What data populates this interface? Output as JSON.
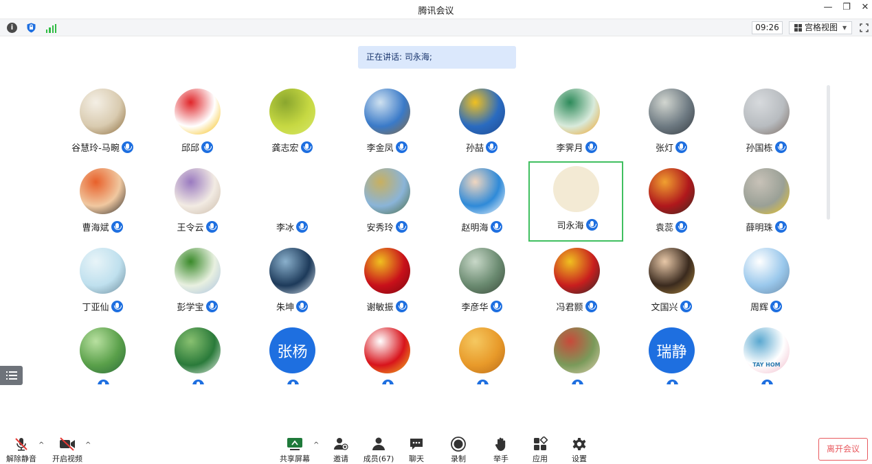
{
  "window": {
    "title": "腾讯会议",
    "minimize_glyph": "—",
    "restore_glyph": "❐",
    "close_glyph": "✕"
  },
  "status": {
    "info_icon": "i",
    "time": "09:26",
    "view_label": "宫格视图",
    "view_caret": "▼"
  },
  "speaking": {
    "text": "正在讲话: 司永海;"
  },
  "participants": [
    {
      "name": "谷慧玲-马畹",
      "avatar": "teacup",
      "colors": [
        "#d9cbb0",
        "#f4efe5",
        "#8a6a3a"
      ]
    },
    {
      "name": "邱邱",
      "avatar": "logo-red",
      "colors": [
        "#ffffff",
        "#e0262a",
        "#f5b800"
      ]
    },
    {
      "name": "龚志宏",
      "avatar": "tree",
      "colors": [
        "#c6d842",
        "#8aa62e",
        "#d8e86a"
      ]
    },
    {
      "name": "李金凤",
      "avatar": "person-field",
      "colors": [
        "#3a7ac8",
        "#cfe1f0",
        "#8a6a3c"
      ]
    },
    {
      "name": "孙喆",
      "avatar": "yellow-leaves",
      "colors": [
        "#2a6bc0",
        "#f0c020",
        "#1f4a90"
      ]
    },
    {
      "name": "李霁月",
      "avatar": "umbrella",
      "colors": [
        "#d8eadb",
        "#2d8a5a",
        "#f0a020"
      ]
    },
    {
      "name": "张灯",
      "avatar": "child-window",
      "colors": [
        "#6e7a82",
        "#d2d6d0",
        "#343a40"
      ]
    },
    {
      "name": "孙国栋",
      "avatar": "building",
      "colors": [
        "#b8bcc0",
        "#d7dadd",
        "#7a6a60"
      ]
    },
    {
      "name": "曹海斌",
      "avatar": "boy-glasses",
      "colors": [
        "#f0c8a0",
        "#e8602a",
        "#2a2a2a"
      ]
    },
    {
      "name": "王令云",
      "avatar": "lavender",
      "colors": [
        "#f2ebe3",
        "#9a7ac0",
        "#c9b8a6"
      ]
    },
    {
      "name": "李冰",
      "avatar": "calligraphy",
      "colors": [
        "#ffffff",
        "#111111",
        "#9e9e9e"
      ]
    },
    {
      "name": "安秀玲",
      "avatar": "lake-trees",
      "colors": [
        "#8ab4d8",
        "#c8b060",
        "#4a6a40"
      ]
    },
    {
      "name": "赵明海",
      "avatar": "man-portrait",
      "colors": [
        "#2f8ad8",
        "#f0d6c0",
        "#ffffff"
      ]
    },
    {
      "name": "司永海",
      "avatar": "si-calligraphy",
      "colors": [
        "#f3ead4",
        "#222222",
        "#e07a9a"
      ]
    },
    {
      "name": "袁蕊",
      "avatar": "tiger",
      "colors": [
        "#b0181c",
        "#f0a030",
        "#3a2a20"
      ]
    },
    {
      "name": "薛明珠",
      "avatar": "blossom",
      "colors": [
        "#9aa096",
        "#c8c2b8",
        "#f0c820"
      ]
    },
    {
      "name": "丁亚仙",
      "avatar": "kid-sky",
      "colors": [
        "#bfe0ee",
        "#e8f4f8",
        "#6a8a9a"
      ]
    },
    {
      "name": "彭学宝",
      "avatar": "garden",
      "colors": [
        "#e8f0e0",
        "#3a8a2a",
        "#a8c0e0"
      ]
    },
    {
      "name": "朱坤",
      "avatar": "skyscraper",
      "colors": [
        "#1d3a5a",
        "#8ab0cc",
        "#dde8f0"
      ]
    },
    {
      "name": "谢敏振",
      "avatar": "star",
      "colors": [
        "#c8101a",
        "#f0c020",
        "#7a0810"
      ]
    },
    {
      "name": "李彦华",
      "avatar": "succulent",
      "colors": [
        "#6a8a70",
        "#c8d8c8",
        "#3a4a3a"
      ]
    },
    {
      "name": "冯君颢",
      "avatar": "cartoon",
      "colors": [
        "#c81e1e",
        "#f0c020",
        "#2a2a2a"
      ]
    },
    {
      "name": "文国兴",
      "avatar": "graduate",
      "colors": [
        "#3a2a1e",
        "#e8c8a8",
        "#b08a40"
      ]
    },
    {
      "name": "周辉",
      "avatar": "tower",
      "colors": [
        "#9ac8ec",
        "#ffffff",
        "#6a8aa8"
      ]
    },
    {
      "name": "",
      "avatar": "green-lake",
      "colors": [
        "#5aa04a",
        "#b8e0a0",
        "#2a6a3a"
      ]
    },
    {
      "name": "",
      "avatar": "tea-hills",
      "colors": [
        "#2a7a3a",
        "#88c070",
        "#e8f0e8"
      ]
    },
    {
      "name": "",
      "avatar": "text-avatar",
      "text": "张杨",
      "colors": [
        "#1e6fe0"
      ]
    },
    {
      "name": "",
      "avatar": "rabbit",
      "colors": [
        "#d8141c",
        "#ffffff",
        "#f0c020"
      ]
    },
    {
      "name": "",
      "avatar": "desert",
      "colors": [
        "#e89a2a",
        "#f5c860",
        "#b86a18"
      ]
    },
    {
      "name": "",
      "avatar": "apples",
      "colors": [
        "#7a9a5a",
        "#c84a3a",
        "#e0d0b0"
      ]
    },
    {
      "name": "",
      "avatar": "text-avatar",
      "text": "瑞静",
      "colors": [
        "#1e6fe0"
      ]
    },
    {
      "name": "",
      "avatar": "tayhom",
      "colors": [
        "#ffffff",
        "#5aa8d0",
        "#f0b8c8"
      ],
      "label": "TAY HOM"
    }
  ],
  "bottom": {
    "unmute": "解除静音",
    "start_video": "开启视频",
    "share_screen": "共享屏幕",
    "invite": "邀请",
    "members": "成员(67)",
    "chat": "聊天",
    "record": "录制",
    "raise_hand": "举手",
    "apps": "应用",
    "settings": "设置",
    "leave": "离开会议",
    "chevron": "^"
  }
}
